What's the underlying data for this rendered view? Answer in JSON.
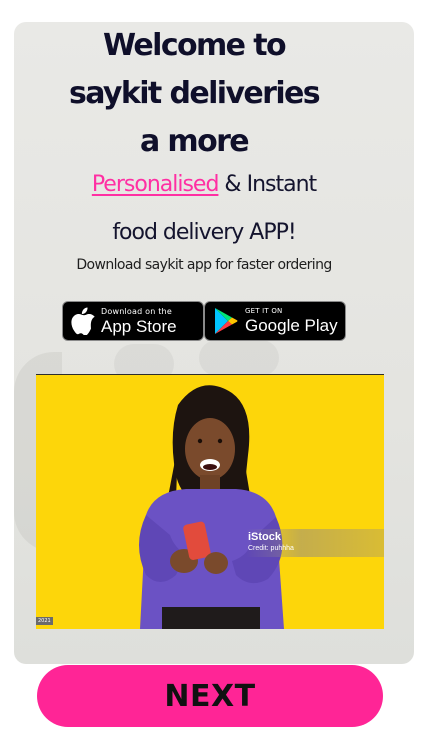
{
  "headline": {
    "line1": "Welcome to",
    "line2": "saykit deliveries",
    "line3": "a more"
  },
  "tagline": {
    "highlight": "Personalised",
    "rest": " & Instant",
    "line2": "food delivery APP!"
  },
  "subtitle": "Download saykit app for faster ordering",
  "stores": {
    "apple": {
      "small": "Download on the",
      "big": "App Store",
      "icon": "apple-icon"
    },
    "google": {
      "small": "GET IT ON",
      "big": "Google Play",
      "icon": "google-play-icon"
    }
  },
  "hero_image": {
    "watermark_brand": "iStock",
    "watermark_credit": "Credit: puhhha",
    "corner_tag": "2021"
  },
  "next_button": "NEXT",
  "colors": {
    "accent": "#ff2596",
    "highlight_text": "#ff2fa3",
    "photo_background": "#fdd60a"
  }
}
